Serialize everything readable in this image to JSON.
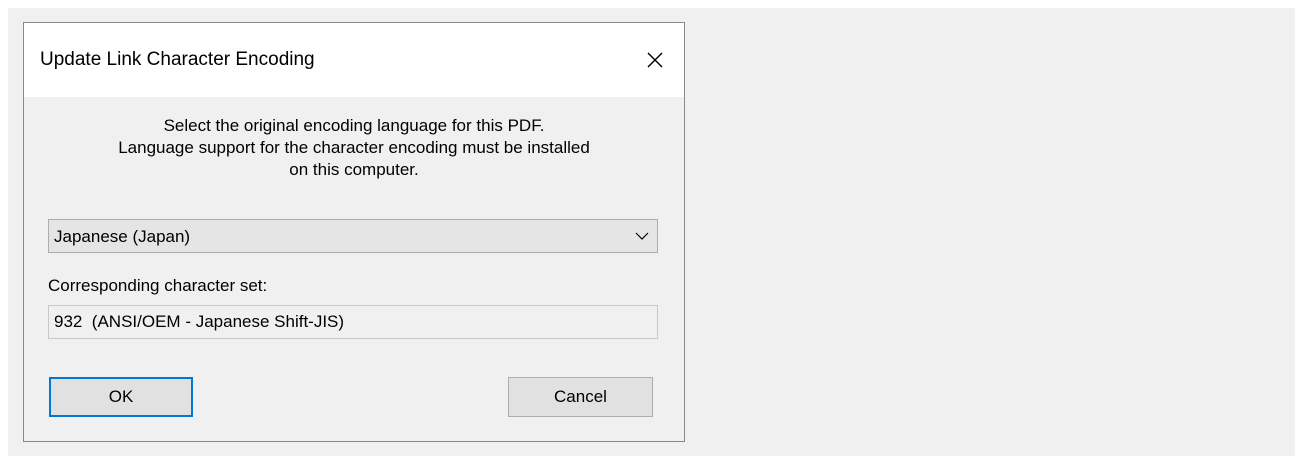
{
  "dialog": {
    "title": "Update Link Character Encoding",
    "close_icon": "close-icon",
    "instructions": [
      "Select the original encoding language for this PDF.",
      "Language support for the character encoding must be installed",
      "on this computer."
    ],
    "language_select": {
      "selected": "Japanese (Japan)",
      "icon": "chevron-down-icon"
    },
    "charset_label": "Corresponding character set:",
    "charset_value": "932  (ANSI/OEM - Japanese Shift-JIS)",
    "ok_label": "OK",
    "cancel_label": "Cancel"
  },
  "colors": {
    "client_background": "#f0f0f0",
    "default_button_border": "#0078d7",
    "button_background": "#e1e1e1"
  }
}
